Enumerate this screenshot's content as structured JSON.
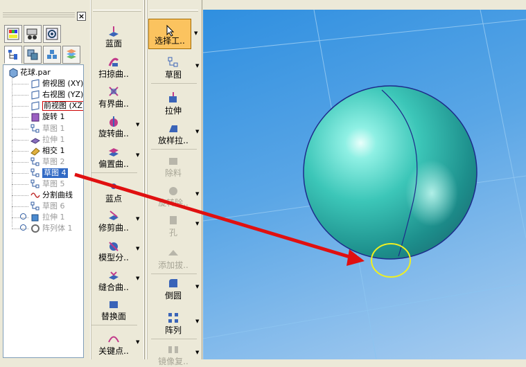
{
  "tree_panel": {
    "close_glyph": "×",
    "tree": [
      {
        "label": "花球.par",
        "icon": "part-icon",
        "state": "normal"
      },
      {
        "label": "俯视图 (XY)",
        "icon": "plane-icon",
        "state": "normal"
      },
      {
        "label": "右视图 (YZ)",
        "icon": "plane-icon",
        "state": "normal"
      },
      {
        "label": "前视图 (XZ)",
        "icon": "plane-icon",
        "state": "boxed"
      },
      {
        "label": "旋转 1",
        "icon": "revolve-feature-icon",
        "state": "normal"
      },
      {
        "label": "草图 1",
        "icon": "sketch-icon",
        "state": "gray"
      },
      {
        "label": "拉伸 1",
        "icon": "extrude-surface-icon",
        "state": "gray"
      },
      {
        "label": "相交 1",
        "icon": "intersect-icon",
        "state": "normal"
      },
      {
        "label": "草图 2",
        "icon": "sketch-icon",
        "state": "gray"
      },
      {
        "label": "草图 4",
        "icon": "sketch-icon",
        "state": "selected"
      },
      {
        "label": "草图 5",
        "icon": "sketch-icon",
        "state": "gray"
      },
      {
        "label": "分割曲线",
        "icon": "split-curve-icon",
        "state": "normal"
      },
      {
        "label": "草图 6",
        "icon": "sketch-icon",
        "state": "gray"
      },
      {
        "label": "拉伸 1",
        "icon": "extrude-icon",
        "state": "gray"
      },
      {
        "label": "阵列体 1",
        "icon": "pattern-body-icon",
        "state": "gray"
      }
    ]
  },
  "surface_toolbar": {
    "buttons": [
      {
        "label": "蓝面",
        "icon": "blue-surface-icon",
        "dropdown": false,
        "enabled": true
      },
      {
        "label": "扫掠曲..",
        "icon": "swept-surface-icon",
        "dropdown": false,
        "enabled": true
      },
      {
        "label": "有界曲..",
        "icon": "bounded-surface-icon",
        "dropdown": false,
        "enabled": true
      },
      {
        "label": "旋转曲..",
        "icon": "revolved-surface-icon",
        "dropdown": true,
        "enabled": true
      },
      {
        "label": "偏置曲..",
        "icon": "offset-surface-icon",
        "dropdown": true,
        "enabled": true
      },
      {
        "label": "蓝点",
        "icon": "blue-dot-icon",
        "dropdown": false,
        "enabled": true
      },
      {
        "label": "修剪曲..",
        "icon": "trim-surface-icon",
        "dropdown": true,
        "enabled": true
      },
      {
        "label": "模型分..",
        "icon": "split-model-icon",
        "dropdown": true,
        "enabled": true
      },
      {
        "label": "缝合曲..",
        "icon": "stitch-surface-icon",
        "dropdown": true,
        "enabled": true
      },
      {
        "label": "替换面",
        "icon": "replace-face-icon",
        "dropdown": false,
        "enabled": true
      },
      {
        "label": "关键点..",
        "icon": "keypoint-curve-icon",
        "dropdown": true,
        "enabled": true
      }
    ]
  },
  "feature_toolbar": {
    "buttons": [
      {
        "label": "选择工..",
        "icon": "select-tool-icon",
        "dropdown": true,
        "enabled": true,
        "active": true
      },
      {
        "label": "草图",
        "icon": "sketch-tool-icon",
        "dropdown": true,
        "enabled": true
      },
      {
        "label": "拉伸",
        "icon": "extrude-tool-icon",
        "dropdown": false,
        "enabled": true
      },
      {
        "label": "放样拉..",
        "icon": "loft-tool-icon",
        "dropdown": true,
        "enabled": true
      },
      {
        "label": "除料",
        "icon": "cutout-tool-icon",
        "dropdown": false,
        "enabled": false
      },
      {
        "label": "旋转除..",
        "icon": "revolved-cutout-icon",
        "dropdown": true,
        "enabled": false
      },
      {
        "label": "孔",
        "icon": "hole-tool-icon",
        "dropdown": true,
        "enabled": false
      },
      {
        "label": "添加拔..",
        "icon": "draft-tool-icon",
        "dropdown": false,
        "enabled": false
      },
      {
        "label": "倒圆",
        "icon": "round-tool-icon",
        "dropdown": true,
        "enabled": true
      },
      {
        "label": "阵列",
        "icon": "pattern-tool-icon",
        "dropdown": true,
        "enabled": true
      },
      {
        "label": "镜像复..",
        "icon": "mirror-tool-icon",
        "dropdown": true,
        "enabled": false
      }
    ]
  },
  "colors": {
    "viewport_top": "#2f8fe0",
    "sphere": "#3cc6b8",
    "annotation_arrow": "#e01010",
    "highlight_circle": "#f0f020",
    "tree_selection": "#316ac5"
  }
}
